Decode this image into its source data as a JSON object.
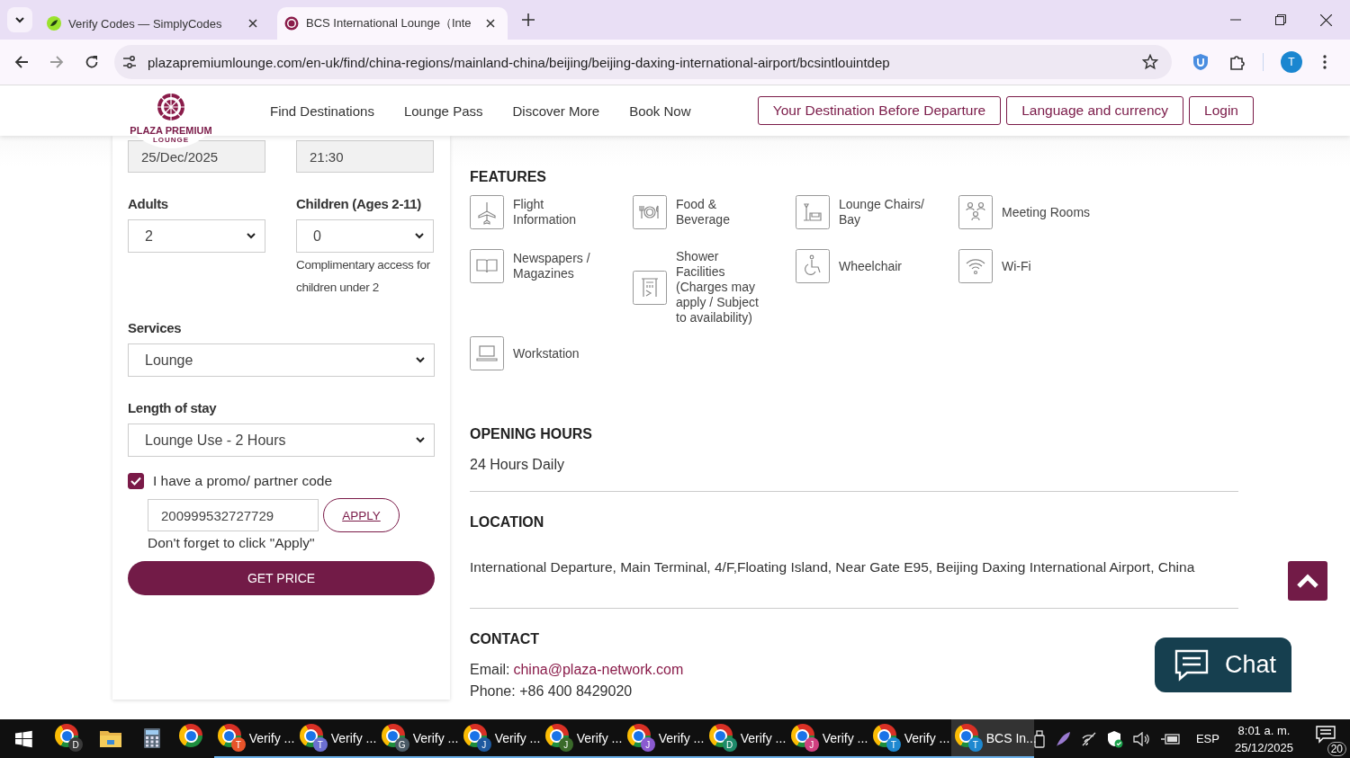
{
  "browser": {
    "tabs": [
      {
        "title": "Verify Codes — SimplyCodes",
        "kind": "simplycodes",
        "selected": false
      },
      {
        "title": "BCS International Lounge（Inte",
        "kind": "plaza",
        "selected": true
      }
    ],
    "address": "plazapremiumlounge.com/en-uk/find/china-regions/mainland-china/beijing/beijing-daxing-international-airport/bcsintlouintdep",
    "profile": "T"
  },
  "header": {
    "logo": {
      "name": "PLAZA PREMIUM",
      "sub": "LOUNGE"
    },
    "nav": [
      "Find Destinations",
      "Lounge Pass",
      "Discover More",
      "Book Now"
    ],
    "actions": [
      "Your Destination Before Departure",
      "Language and currency",
      "Login"
    ]
  },
  "booking": {
    "date": "25/Dec/2025",
    "time": "21:30",
    "adults_label": "Adults",
    "adults": "2",
    "children_label": "Children (Ages 2-11)",
    "children": "0",
    "children_note": "Complimentary access for children under 2",
    "services_label": "Services",
    "services": "Lounge",
    "length_label": "Length of stay",
    "length": "Lounge Use - 2 Hours",
    "promo": {
      "checked": true,
      "label": "I have a promo/ partner code",
      "code": "200999532727729",
      "apply": "APPLY",
      "note": "Don't forget to click \"Apply\""
    },
    "submit": "GET PRICE"
  },
  "features": {
    "title": "FEATURES",
    "items": [
      {
        "label": "Flight Information",
        "kind": "plane"
      },
      {
        "label": "Food & Beverage",
        "kind": "food"
      },
      {
        "label": "Lounge Chairs/ Bay",
        "kind": "chair"
      },
      {
        "label": "Meeting Rooms",
        "kind": "meeting"
      },
      {
        "label": "Newspapers / Magazines",
        "kind": "book"
      },
      {
        "label": "Shower Facilities (Charges may apply / Subject to availability)",
        "kind": "shower"
      },
      {
        "label": "Wheelchair",
        "kind": "wheelchair"
      },
      {
        "label": "Wi-Fi",
        "kind": "wifi"
      },
      {
        "label": "Workstation",
        "kind": "laptop"
      }
    ]
  },
  "opening_hours": {
    "title": "OPENING HOURS",
    "text": "24 Hours Daily"
  },
  "location": {
    "title": "LOCATION",
    "text": "International Departure, Main Terminal, 4/F,Floating Island, Near Gate E95, Beijing Daxing International Airport, China"
  },
  "contact": {
    "title": "CONTACT",
    "email_label": "Email:",
    "email": "china@plaza-network.com",
    "phone": "Phone: +86 400 8429020"
  },
  "chat": "Chat",
  "taskbar": {
    "items": [
      {
        "kind": "chrome",
        "badge": "D",
        "color": "#3a3a3a",
        "selected": false
      },
      {
        "kind": "files",
        "selected": false
      },
      {
        "kind": "calculator",
        "selected": false
      },
      {
        "kind": "chrome",
        "selected": false
      },
      {
        "kind": "chrome",
        "label": "Verify ...",
        "badge": "T",
        "color": "#e8542a",
        "selected": false
      },
      {
        "kind": "chrome",
        "label": "Verify ...",
        "badge": "T",
        "color": "#6b6fd0",
        "selected": false
      },
      {
        "kind": "chrome",
        "label": "Verify ...",
        "badge": "G",
        "color": "#4a5a66",
        "selected": false
      },
      {
        "kind": "chrome",
        "label": "Verify ...",
        "badge": "J",
        "color": "#1e5aa0",
        "selected": false
      },
      {
        "kind": "chrome",
        "label": "Verify ...",
        "badge": "J",
        "color": "#3a6a2a",
        "selected": false
      },
      {
        "kind": "chrome",
        "label": "Verify ...",
        "badge": "J",
        "color": "#8a5ad0",
        "selected": false
      },
      {
        "kind": "chrome",
        "label": "Verify ...",
        "badge": "D",
        "color": "#1e8a6a",
        "selected": false
      },
      {
        "kind": "chrome",
        "label": "Verify ...",
        "badge": "J",
        "color": "#d04080",
        "selected": false
      },
      {
        "kind": "chrome",
        "label": "Verify ...",
        "badge": "T",
        "color": "#1e88d0",
        "selected": false
      },
      {
        "kind": "chrome",
        "label": "BCS In...",
        "badge": "T",
        "color": "#1e88d0",
        "selected": true
      }
    ],
    "language": "ESP",
    "time": "8:01 a. m.",
    "date": "25/12/2025",
    "notifications": "20"
  }
}
